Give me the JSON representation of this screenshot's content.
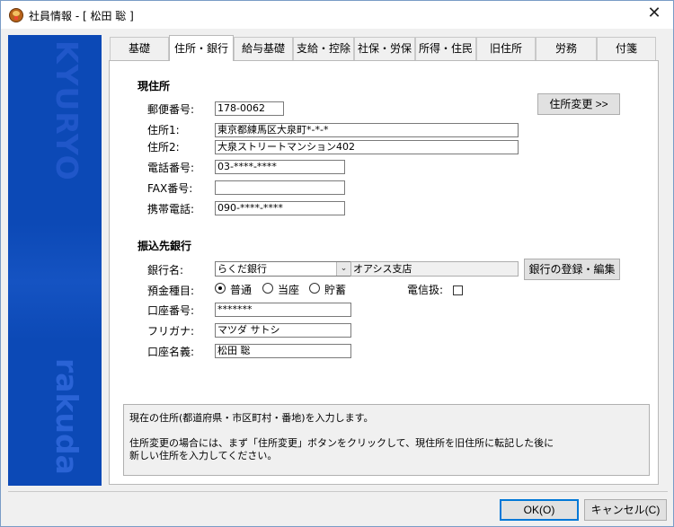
{
  "window": {
    "title": "社員情報 - [ 松田 聡 ]",
    "close_glyph": "✕"
  },
  "sidebar": {
    "logo_top": "KYURYO",
    "logo_bottom": "rakuda"
  },
  "tabs": [
    {
      "label": "基礎"
    },
    {
      "label": "住所・銀行"
    },
    {
      "label": "給与基礎"
    },
    {
      "label": "支給・控除"
    },
    {
      "label": "社保・労保"
    },
    {
      "label": "所得・住民"
    },
    {
      "label": "旧住所"
    },
    {
      "label": "労務"
    },
    {
      "label": "付箋"
    }
  ],
  "address": {
    "section_title": "現住所",
    "postal_label": "郵便番号:",
    "postal_value": "178-0062",
    "addr1_label": "住所1:",
    "addr1_value": "東京都練馬区大泉町*-*-*",
    "addr2_label": "住所2:",
    "addr2_value": "大泉ストリートマンション402",
    "phone_label": "電話番号:",
    "phone_value": "03-****-****",
    "fax_label": "FAX番号:",
    "fax_value": "",
    "mobile_label": "携帯電話:",
    "mobile_value": "090-****-****",
    "change_button": "住所変更 >>"
  },
  "bank": {
    "section_title": "振込先銀行",
    "bank_label": "銀行名:",
    "bank_value": "らくだ銀行",
    "branch_value": "オアシス支店",
    "register_button": "銀行の登録・編集",
    "deposit_label": "預金種目:",
    "deposit_options": [
      "普通",
      "当座",
      "貯蓄"
    ],
    "deposit_selected": "普通",
    "telegram_label": "電信扱:",
    "account_no_label": "口座番号:",
    "account_no_value": "*******",
    "furigana_label": "フリガナ:",
    "furigana_value": "マツダ サトシ",
    "holder_label": "口座名義:",
    "holder_value": "松田 聡"
  },
  "help": {
    "line1": "現在の住所(都道府県・市区町村・番地)を入力します。",
    "line2": "住所変更の場合には、まず「住所変更」ボタンをクリックして、現住所を旧住所に転記した後に",
    "line3": "新しい住所を入力してください。"
  },
  "footer": {
    "ok_label": "OK(O)",
    "cancel_label": "キャンセル(C)"
  },
  "colors": {
    "sidebar": "#0c49b6",
    "accent": "#0078d7"
  }
}
